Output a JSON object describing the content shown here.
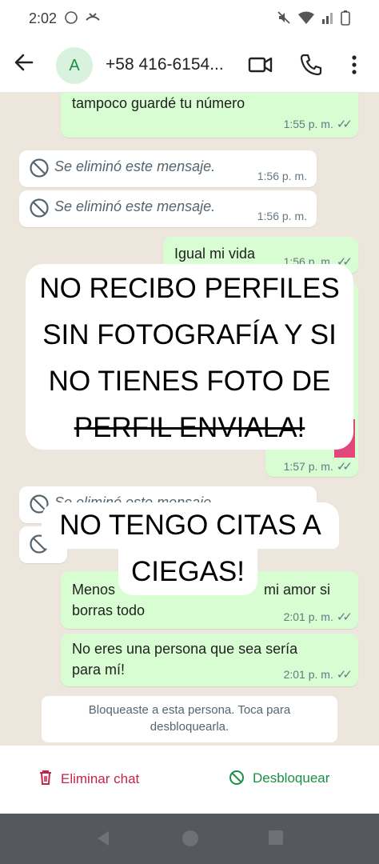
{
  "status_bar": {
    "time": "2:02"
  },
  "header": {
    "back_icon": "arrow-left-icon",
    "avatar_letter": "A",
    "contact_name": "+58 416-6154...",
    "video_icon": "video-camera-icon",
    "call_icon": "phone-icon",
    "menu_icon": "more-vertical-icon"
  },
  "messages": [
    {
      "type": "out",
      "text": "tampoco guardé tu número",
      "time": "1:55 p. m."
    },
    {
      "type": "in_deleted",
      "text": "Se eliminó este mensaje.",
      "time": "1:56 p. m."
    },
    {
      "type": "in_deleted",
      "text": "Se eliminó este mensaje.",
      "time": "1:56 p. m."
    },
    {
      "type": "out",
      "text": "Igual mi vida",
      "time": "1:56 p. m."
    },
    {
      "type": "out_hidden",
      "time": "1:57 p. m."
    },
    {
      "type": "in_deleted",
      "text": "Se eliminó este mensaje"
    },
    {
      "type": "out",
      "text_line1": "Menos",
      "text_line1_right": "mi amor si",
      "text_line2": "borras todo",
      "time": "2:01 p. m."
    },
    {
      "type": "out",
      "text_line1": "No eres una persona que sea sería",
      "text_line2": "para mí!",
      "time": "2:01 p. m."
    }
  ],
  "overlays": {
    "box1": {
      "line1": "NO RECIBO PERFILES",
      "line2": "SIN FOTOGRAFÍA Y SI",
      "line3": "NO TIENES FOTO DE",
      "line4": "PERFIL ENVIALA!"
    },
    "box2": {
      "line1": "NO TENGO CITAS A",
      "line2": "CIEGAS!"
    }
  },
  "system_notice": {
    "line1": "Bloqueaste a esta persona. Toca para",
    "line2": "desbloquearla."
  },
  "bottom_bar": {
    "delete_label": "Eliminar chat",
    "unblock_label": "Desbloquear"
  },
  "colors": {
    "accent_green": "#1a8f45",
    "delete_red": "#c0254a",
    "out_bubble": "#d9fdd3",
    "chat_bg": "#ece6dd"
  }
}
